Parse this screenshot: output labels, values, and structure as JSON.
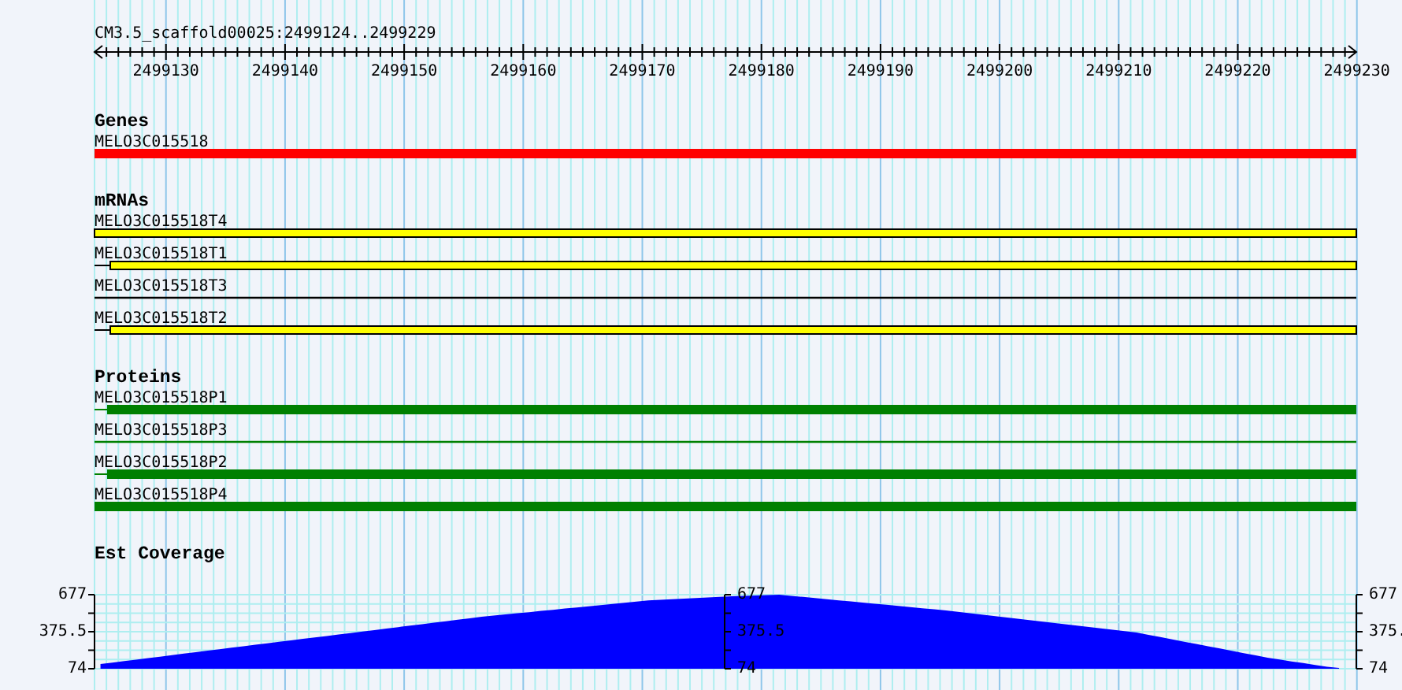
{
  "ruler": {
    "title": "CM3.5_scaffold00025:2499124..2499229",
    "tick_labels": [
      "2499130",
      "2499140",
      "2499150",
      "2499160",
      "2499170",
      "2499180",
      "2499190",
      "2499200",
      "2499210",
      "2499220",
      "2499230"
    ]
  },
  "tracks": [
    {
      "title": "Genes",
      "kind": "gene",
      "features": [
        {
          "label": "MELO3C015518",
          "kind": "full"
        }
      ]
    },
    {
      "title": "mRNAs",
      "kind": "mrna",
      "features": [
        {
          "label": "MELO3C015518T4",
          "kind": "full"
        },
        {
          "label": "MELO3C015518T1",
          "kind": "split"
        },
        {
          "label": "MELO3C015518T3",
          "kind": "line"
        },
        {
          "label": "MELO3C015518T2",
          "kind": "split"
        }
      ]
    },
    {
      "title": "Proteins",
      "kind": "protein",
      "features": [
        {
          "label": "MELO3C015518P1",
          "kind": "split"
        },
        {
          "label": "MELO3C015518P3",
          "kind": "line"
        },
        {
          "label": "MELO3C015518P2",
          "kind": "split"
        },
        {
          "label": "MELO3C015518P4",
          "kind": "full"
        }
      ]
    }
  ],
  "coverage": {
    "title": "Est Coverage",
    "mid_axis_labels": [
      "677",
      "375.5",
      "74"
    ],
    "right_axis_labels": [
      "677",
      "375.",
      "74"
    ],
    "chart_data": {
      "type": "area",
      "ylim": [
        74,
        677
      ],
      "categories": [
        null,
        null,
        null,
        null,
        null,
        null,
        null,
        null,
        null,
        null,
        null,
        null,
        null,
        null,
        null,
        null,
        null,
        null,
        null,
        null,
        null,
        null,
        null,
        null,
        null,
        null,
        null,
        null,
        null,
        null,
        null,
        null,
        null,
        null,
        null,
        null,
        null,
        null,
        null,
        null,
        null,
        null,
        null,
        null,
        null,
        null,
        null,
        null,
        null,
        null,
        null,
        null,
        null,
        null,
        null,
        null,
        null,
        null,
        null,
        null,
        null,
        null,
        null,
        null,
        null,
        null,
        null,
        null,
        null,
        null,
        null,
        null,
        null,
        null,
        null,
        null,
        null,
        null,
        null,
        null,
        null,
        null,
        null,
        null,
        null,
        null,
        null,
        null,
        null,
        null,
        null,
        null,
        null,
        null,
        null,
        null,
        null,
        null,
        null,
        null,
        null,
        null,
        null,
        null,
        null
      ],
      "yticks": [
        {
          "value": 74,
          "label": "74"
        },
        {
          "value": 375.5,
          "label": "375.5"
        },
        {
          "value": 677,
          "label": "677"
        }
      ],
      "series": [
        {
          "color": "#0000ff",
          "values": [
            112,
            124,
            136,
            148,
            160,
            172,
            184,
            197,
            209,
            221,
            233,
            245,
            257,
            269,
            281,
            293,
            305,
            317,
            329,
            341,
            353,
            365,
            377,
            389,
            401,
            413,
            425,
            437,
            449,
            461,
            473,
            485,
            497,
            507,
            516,
            526,
            535,
            545,
            554,
            564,
            573,
            583,
            592,
            602,
            611,
            621,
            630,
            635,
            640,
            645,
            650,
            654,
            659,
            664,
            667,
            670,
            674,
            677,
            668,
            659,
            650,
            640,
            631,
            622,
            613,
            604,
            595,
            586,
            576,
            567,
            558,
            549,
            538,
            527,
            515,
            504,
            493,
            482,
            470,
            459,
            448,
            437,
            425,
            414,
            403,
            392,
            380,
            369,
            350,
            332,
            313,
            294,
            276,
            257,
            239,
            220,
            201,
            183,
            164,
            149,
            134,
            120,
            105,
            90,
            80
          ]
        }
      ]
    }
  }
}
